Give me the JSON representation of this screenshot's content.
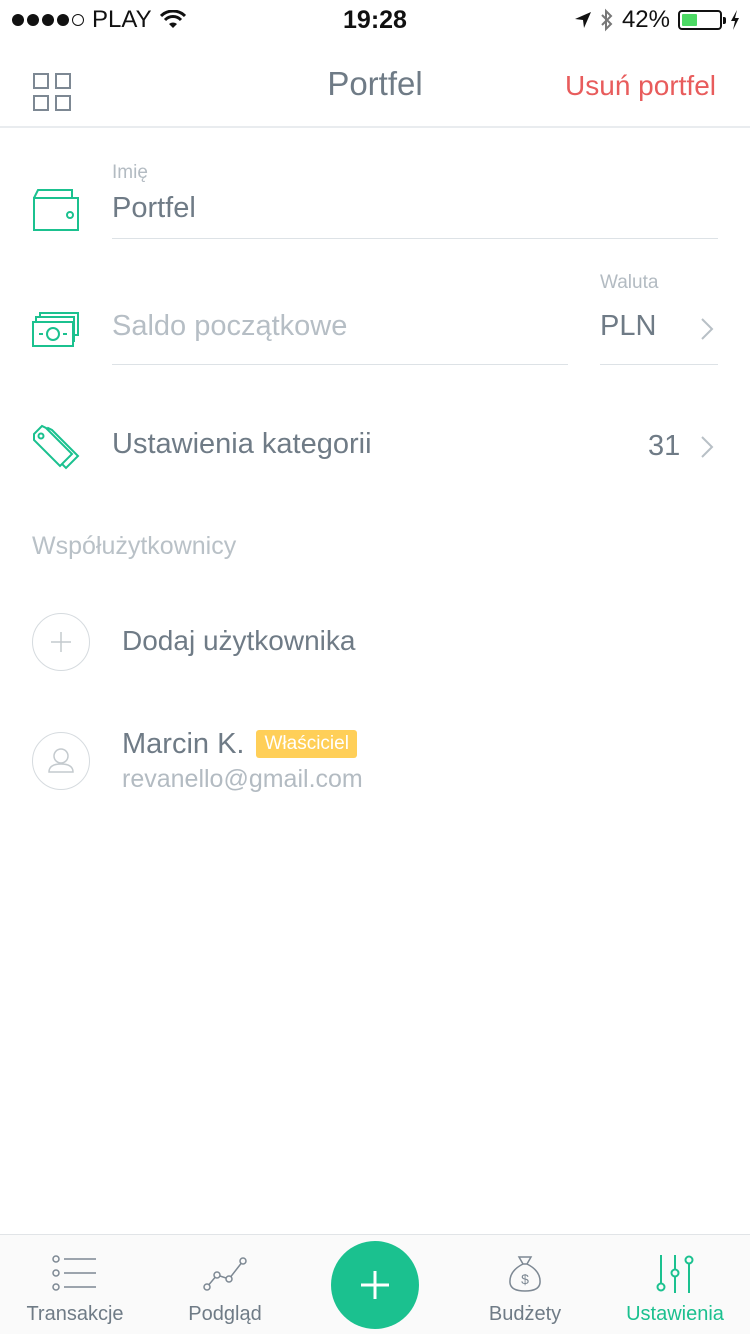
{
  "status_bar": {
    "carrier": "PLAY",
    "time": "19:28",
    "battery_percent": "42%",
    "battery_level": 0.42,
    "battery_color": "#4cd964"
  },
  "header": {
    "title": "Portfel",
    "delete_label": "Usuń portfel",
    "menu_icon": "grid-icon"
  },
  "form": {
    "name_label": "Imię",
    "name_value": "Portfel",
    "balance_placeholder": "Saldo początkowe",
    "currency_label": "Waluta",
    "currency_value": "PLN",
    "categories_label": "Ustawienia kategorii",
    "categories_count": "31"
  },
  "coowners": {
    "section_title": "Współużytkownicy",
    "add_user_label": "Dodaj użytkownika",
    "users": [
      {
        "name": "Marcin K.",
        "role_badge": "Właściciel",
        "email": "revanello@gmail.com"
      }
    ]
  },
  "tabbar": {
    "tabs": [
      {
        "label": "Transakcje",
        "icon": "list-icon",
        "active": false
      },
      {
        "label": "Podgląd",
        "icon": "chart-line-icon",
        "active": false
      },
      {
        "label": "Budżety",
        "icon": "money-bag-icon",
        "active": false
      },
      {
        "label": "Ustawienia",
        "icon": "sliders-icon",
        "active": true
      }
    ],
    "add_icon": "plus-icon"
  },
  "colors": {
    "accent": "#1bc18f",
    "danger": "#e85c5c",
    "badge": "#ffcf58"
  }
}
